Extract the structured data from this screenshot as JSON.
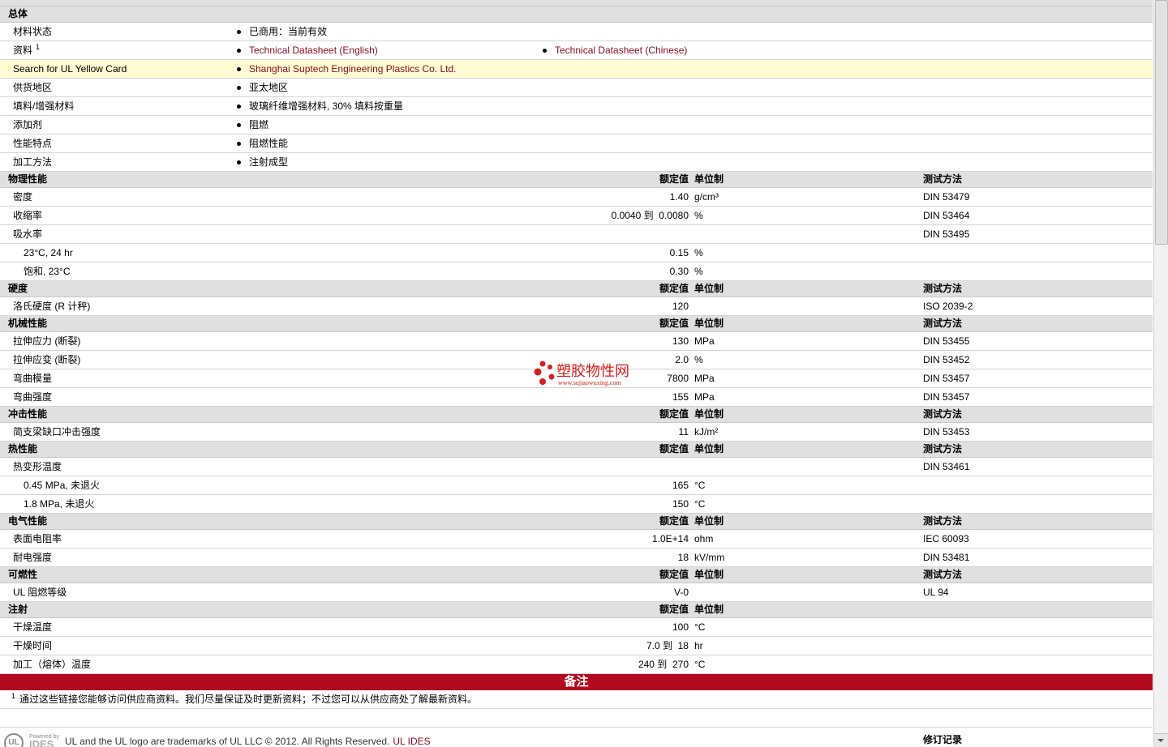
{
  "colors": {
    "header_bg": "#e0e0e0",
    "row_border": "#d4d4d4",
    "highlight_bg": "#fffbd2",
    "link": "#8b0d23",
    "notes_bar": "#b20a1e",
    "watermark": "#d61f1f"
  },
  "general": {
    "title": "总体",
    "rows": [
      {
        "label": "材料状态",
        "items": [
          {
            "text": "已商用：当前有效"
          }
        ]
      },
      {
        "label": "资料",
        "sup": "1",
        "items": [
          {
            "text": "Technical Datasheet (English)",
            "link": true
          },
          {
            "text": "Technical Datasheet (Chinese)",
            "link": true
          }
        ]
      },
      {
        "label": "Search for UL Yellow Card",
        "highlight": true,
        "items": [
          {
            "text": "Shanghai Suptech Engineering Plastics Co. Ltd.",
            "link": true
          }
        ]
      },
      {
        "label": "供货地区",
        "items": [
          {
            "text": "亚太地区"
          }
        ]
      },
      {
        "label": "填料/增强材料",
        "items": [
          {
            "text": "玻璃纤维增强材料, 30% 填料按重量"
          }
        ]
      },
      {
        "label": "添加剂",
        "items": [
          {
            "text": "阻燃"
          }
        ]
      },
      {
        "label": "性能特点",
        "items": [
          {
            "text": "阻燃性能"
          }
        ]
      },
      {
        "label": "加工方法",
        "items": [
          {
            "text": "注射成型"
          }
        ]
      }
    ]
  },
  "columns": {
    "value": "额定值",
    "unit": "单位制",
    "method": "测试方法"
  },
  "sections": [
    {
      "title": "物理性能",
      "show_method": true,
      "rows": [
        {
          "label": "密度",
          "value": "1.40",
          "unit": "g/cm³",
          "method": "DIN 53479"
        },
        {
          "label": "收缩率",
          "value": "0.0040 到  0.0080",
          "unit": "%",
          "method": "DIN 53464"
        },
        {
          "label": "吸水率",
          "method": "DIN 53495"
        },
        {
          "label": "23°C, 24 hr",
          "indent": true,
          "value": "0.15",
          "unit": "%"
        },
        {
          "label": "饱和, 23°C",
          "indent": true,
          "value": "0.30",
          "unit": "%"
        }
      ]
    },
    {
      "title": "硬度",
      "show_method": true,
      "rows": [
        {
          "label": "洛氏硬度 (R 计秤)",
          "value": "120",
          "method": "ISO 2039-2"
        }
      ]
    },
    {
      "title": "机械性能",
      "show_method": true,
      "rows": [
        {
          "label": "拉伸应力 (断裂)",
          "value": "130",
          "unit": "MPa",
          "method": "DIN 53455"
        },
        {
          "label": "拉伸应变 (断裂)",
          "value": "2.0",
          "unit": "%",
          "method": "DIN 53452"
        },
        {
          "label": "弯曲模量",
          "value": "7800",
          "unit": "MPa",
          "method": "DIN 53457"
        },
        {
          "label": "弯曲强度",
          "value": "155",
          "unit": "MPa",
          "method": "DIN 53457"
        }
      ]
    },
    {
      "title": "冲击性能",
      "show_method": true,
      "rows": [
        {
          "label": "简支梁缺口冲击强度",
          "value": "11",
          "unit": "kJ/m²",
          "method": "DIN 53453"
        }
      ]
    },
    {
      "title": "热性能",
      "show_method": true,
      "rows": [
        {
          "label": "热变形温度",
          "method": "DIN 53461"
        },
        {
          "label": "0.45 MPa, 未退火",
          "indent": true,
          "value": "165",
          "unit": "°C"
        },
        {
          "label": "1.8 MPa, 未退火",
          "indent": true,
          "value": "150",
          "unit": "°C"
        }
      ]
    },
    {
      "title": "电气性能",
      "show_method": true,
      "rows": [
        {
          "label": "表面电阻率",
          "value": "1.0E+14",
          "unit": "ohm",
          "method": "IEC 60093"
        },
        {
          "label": "耐电强度",
          "value": "18",
          "unit": "kV/mm",
          "method": "DIN 53481"
        }
      ]
    },
    {
      "title": "可燃性",
      "show_method": true,
      "rows": [
        {
          "label": "UL 阻燃等级",
          "value": "V-0",
          "method": "UL 94"
        }
      ]
    },
    {
      "title": "注射",
      "show_method": false,
      "rows": [
        {
          "label": "干燥温度",
          "value": "100",
          "unit": "°C"
        },
        {
          "label": "干燥时间",
          "value": "7.0 到  18",
          "unit": "hr"
        },
        {
          "label": "加工（熔体）温度",
          "value": "240 到  270",
          "unit": "°C"
        }
      ]
    }
  ],
  "notes": {
    "title": "备注",
    "items": [
      {
        "sup": "1",
        "text": "通过这些链接您能够访问供应商资料。我们尽量保证及时更新资料；不过您可以从供应商处了解最新资料。"
      }
    ]
  },
  "footer": {
    "logo": "UL",
    "powered_by": "Powered by",
    "brand": "IDES",
    "copyright": "UL and the UL logo are trademarks of UL LLC © 2012. All Rights Reserved.",
    "link": "UL IDES",
    "revision": "修订记录"
  },
  "watermark": {
    "text": "塑胶物性网",
    "url": "www.sujiaowuxing.com"
  }
}
